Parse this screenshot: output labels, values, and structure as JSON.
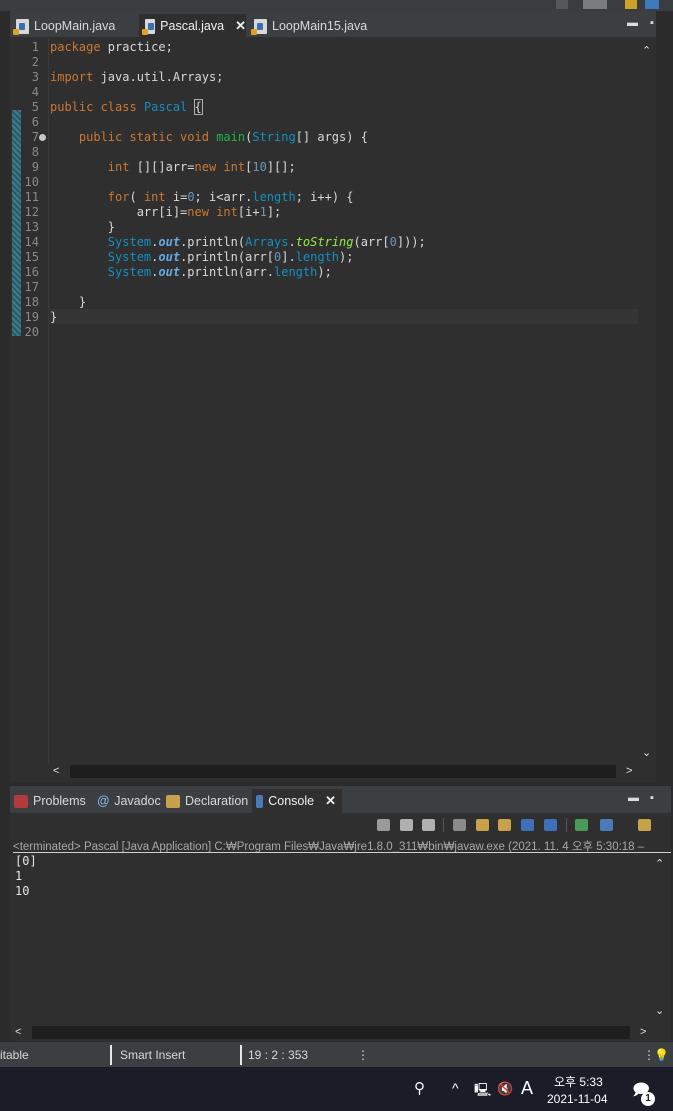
{
  "editor": {
    "tabs": [
      {
        "label": "LoopMain.java",
        "active": false
      },
      {
        "label": "Pascal.java",
        "active": true,
        "close": "✕"
      },
      {
        "label": "LoopMain15.java",
        "active": false
      }
    ],
    "line_numbers": [
      "1",
      "2",
      "3",
      "4",
      "5",
      "6",
      "7",
      "8",
      "9",
      "10",
      "11",
      "12",
      "13",
      "14",
      "15",
      "16",
      "17",
      "18",
      "19",
      "20"
    ],
    "code": {
      "l1_kw": "package",
      "l1_rest": " practice;",
      "l3_kw": "import",
      "l3_rest": " java.util.Arrays;",
      "l5_kw": "public class",
      "l5_sp": " ",
      "l5_type": "Pascal",
      "l5_sp2": " ",
      "l5_brace": "{",
      "l7_indent": "    ",
      "l7_kw": "public static void",
      "l7_sp": " ",
      "l7_fn": "main",
      "l7_p1": "(",
      "l7_type": "String",
      "l7_p2": "[] args) {",
      "l9_indent": "        ",
      "l9_kw": "int",
      "l9_a": " [][]arr=",
      "l9_kw2": "new",
      "l9_sp": " ",
      "l9_kw3": "int",
      "l9_b": "[",
      "l9_num": "10",
      "l9_c": "][];",
      "l11_indent": "        ",
      "l11_kw": "for",
      "l11_a": "( ",
      "l11_kw2": "int",
      "l11_b": " i=",
      "l11_num": "0",
      "l11_c": "; i<arr.",
      "l11_fld": "length",
      "l11_d": "; i++) {",
      "l12_indent": "            ",
      "l12_a": "arr[i]=",
      "l12_kw": "new",
      "l12_sp": " ",
      "l12_kw2": "int",
      "l12_b": "[i+",
      "l12_num": "1",
      "l12_c": "];",
      "l13": "        }",
      "l14_indent": "        ",
      "l14_sys": "System",
      "l14_dot": ".",
      "l14_out": "out",
      "l14_a": ".println(",
      "l14_type": "Arrays",
      "l14_dot2": ".",
      "l14_st": "toString",
      "l14_b": "(arr[",
      "l14_num": "0",
      "l14_c": "]));",
      "l15_indent": "        ",
      "l15_sys": "System",
      "l15_dot": ".",
      "l15_out": "out",
      "l15_a": ".println(arr[",
      "l15_num": "0",
      "l15_b": "].",
      "l15_fld": "length",
      "l15_c": ");",
      "l16_indent": "        ",
      "l16_sys": "System",
      "l16_dot": ".",
      "l16_out": "out",
      "l16_a": ".println(arr.",
      "l16_fld": "length",
      "l16_c": ");",
      "l18": "    }",
      "l19": "}"
    }
  },
  "console": {
    "tabs": [
      {
        "label": "Problems"
      },
      {
        "label": "Javadoc"
      },
      {
        "label": "Declaration"
      },
      {
        "label": "Console",
        "active": true,
        "close": "✕"
      }
    ],
    "status": "<terminated> Pascal [Java Application] C:₩Program Files₩Java₩jre1.8.0_311₩bin₩javaw.exe  (2021. 11. 4 오후 5:30:18 –",
    "output": [
      "[0]",
      "1",
      "10"
    ]
  },
  "statusbar": {
    "writable": "itable",
    "insert_mode": "Smart Insert",
    "position": "19 : 2 : 353"
  },
  "taskbar": {
    "ime": "A",
    "time": "오후 5:33",
    "date": "2021-11-04",
    "notification_count": "1"
  },
  "scroll_glyphs": {
    "up": "⌃",
    "down": "⌄",
    "left": "<",
    "right": ">"
  }
}
